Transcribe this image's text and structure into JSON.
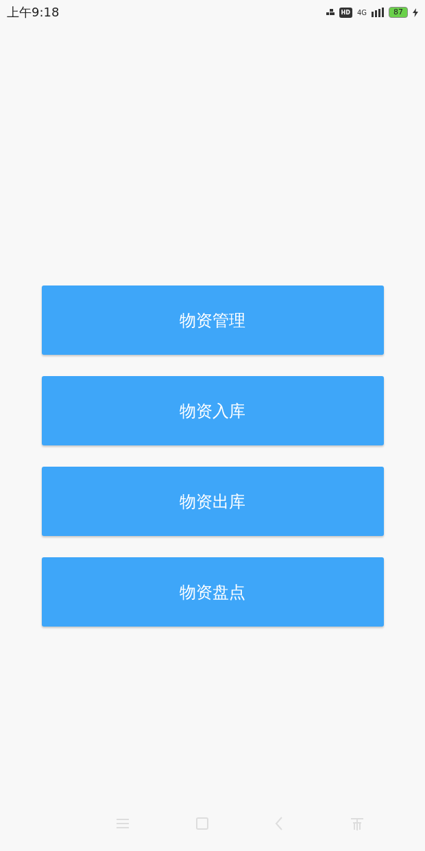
{
  "status_bar": {
    "time": "上午9:18",
    "hd_badge": "HD",
    "network": "4G",
    "battery": "87",
    "charging": true
  },
  "menu_buttons": [
    {
      "label": "物资管理"
    },
    {
      "label": "物资入库"
    },
    {
      "label": "物资出库"
    },
    {
      "label": "物资盘点"
    }
  ]
}
